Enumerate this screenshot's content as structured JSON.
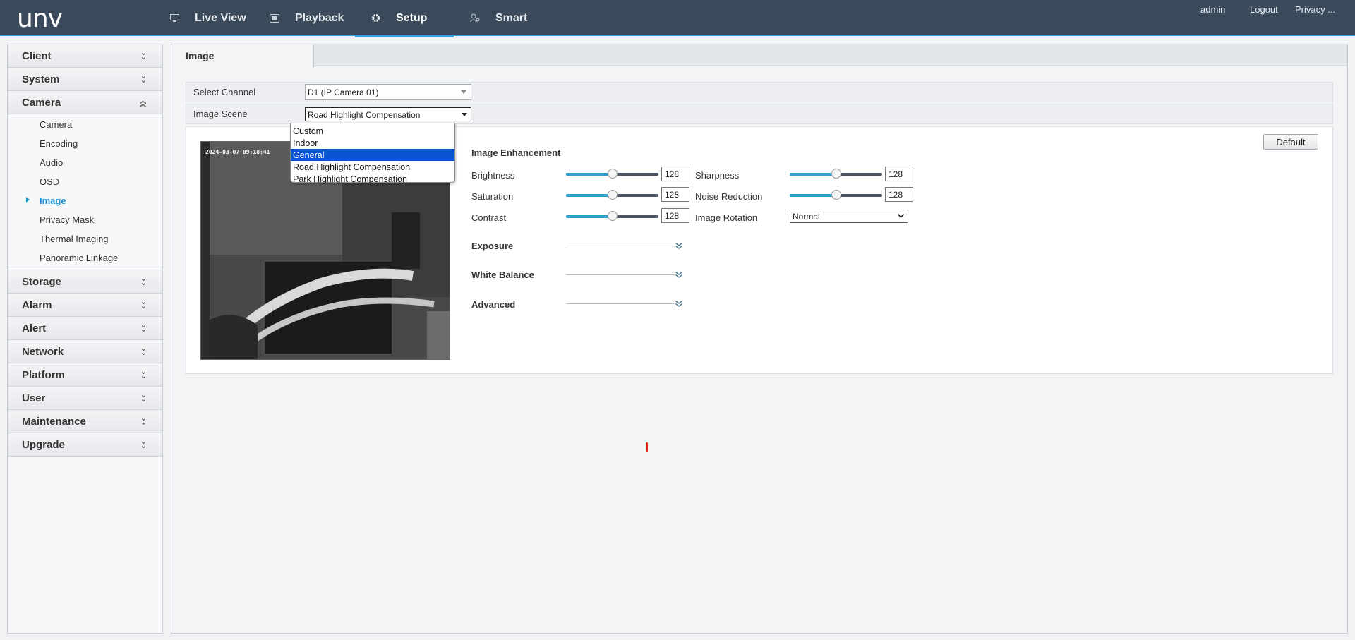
{
  "header": {
    "logo": "unv",
    "nav": [
      {
        "label": "Live View",
        "icon": "monitor-icon"
      },
      {
        "label": "Playback",
        "icon": "film-icon"
      },
      {
        "label": "Setup",
        "icon": "gear-icon",
        "active": true
      },
      {
        "label": "Smart",
        "icon": "person-search-icon"
      }
    ],
    "user": "admin",
    "logout": "Logout",
    "privacy": "Privacy ..."
  },
  "sidebar": {
    "groups": [
      {
        "label": "Client"
      },
      {
        "label": "System"
      },
      {
        "label": "Camera",
        "expanded": true
      },
      {
        "label": "Storage"
      },
      {
        "label": "Alarm"
      },
      {
        "label": "Alert"
      },
      {
        "label": "Network"
      },
      {
        "label": "Platform"
      },
      {
        "label": "User"
      },
      {
        "label": "Maintenance"
      },
      {
        "label": "Upgrade"
      }
    ],
    "camera_items": [
      {
        "label": "Camera"
      },
      {
        "label": "Encoding"
      },
      {
        "label": "Audio"
      },
      {
        "label": "OSD"
      },
      {
        "label": "Image",
        "active": true
      },
      {
        "label": "Privacy Mask"
      },
      {
        "label": "Thermal Imaging"
      },
      {
        "label": "Panoramic Linkage"
      }
    ]
  },
  "main": {
    "tab": "Image",
    "select_channel_label": "Select Channel",
    "select_channel_value": "D1 (IP Camera 01)",
    "image_scene_label": "Image Scene",
    "image_scene_value": "Road Highlight Compensation",
    "scene_options": [
      "Custom",
      "Indoor",
      "General",
      "Road Highlight Compensation",
      "Park Highlight Compensation"
    ],
    "scene_highlighted": "General",
    "preview_timestamp": "2024-03-07 09:18:41",
    "default_button": "Default",
    "image_enhancement_title": "Image Enhancement",
    "params": {
      "brightness": {
        "label": "Brightness",
        "value": "128",
        "level": 0.5
      },
      "saturation": {
        "label": "Saturation",
        "value": "128",
        "level": 0.5
      },
      "contrast": {
        "label": "Contrast",
        "value": "128",
        "level": 0.5
      },
      "sharpness": {
        "label": "Sharpness",
        "value": "128",
        "level": 0.5
      },
      "noise_reduction": {
        "label": "Noise Reduction",
        "value": "128",
        "level": 0.5
      }
    },
    "image_rotation_label": "Image Rotation",
    "image_rotation_value": "Normal",
    "sections": {
      "exposure": "Exposure",
      "white_balance": "White Balance",
      "advanced": "Advanced"
    }
  },
  "colors": {
    "header_bg": "#3a4a5b",
    "accent": "#2aa8d8",
    "active_link": "#1e90d0",
    "dropdown_highlight": "#0a55d6"
  }
}
